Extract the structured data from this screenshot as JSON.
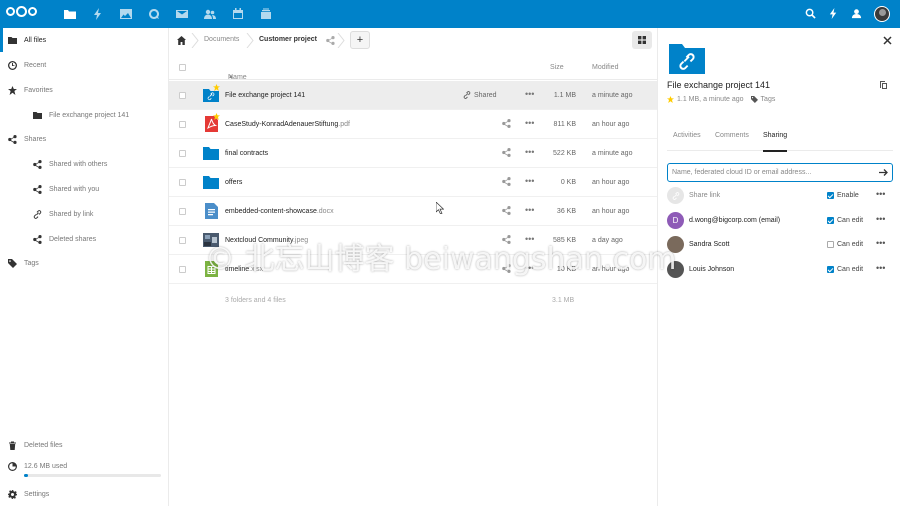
{
  "brand": {
    "accent": "#0082c9"
  },
  "topbar": {
    "apps": [
      "files-icon",
      "activity-icon",
      "gallery-icon",
      "talk-icon",
      "mail-icon",
      "contacts-icon",
      "calendar-icon",
      "deck-icon"
    ],
    "right_icons": [
      "search-icon",
      "notifications-icon",
      "contacts-menu-icon",
      "user-avatar"
    ]
  },
  "sidebar": {
    "items": [
      {
        "label": "All files",
        "icon": "folder-icon"
      },
      {
        "label": "Recent",
        "icon": "clock-icon"
      },
      {
        "label": "Favorites",
        "icon": "star-icon"
      },
      {
        "label": "File exchange project 141",
        "icon": "folder-icon"
      },
      {
        "label": "Shares",
        "icon": "share-icon"
      },
      {
        "label": "Shared with others",
        "icon": "share-icon"
      },
      {
        "label": "Shared with you",
        "icon": "share-icon"
      },
      {
        "label": "Shared by link",
        "icon": "link-icon"
      },
      {
        "label": "Deleted shares",
        "icon": "share-icon"
      },
      {
        "label": "Tags",
        "icon": "tag-icon"
      }
    ],
    "deleted_files": "Deleted files",
    "quota": "12.6 MB used",
    "quota_fraction": 0.03,
    "settings": "Settings"
  },
  "breadcrumb": {
    "items": [
      "Documents",
      "Customer project"
    ],
    "add_label": "+"
  },
  "table": {
    "col_name": "Name",
    "col_size": "Size",
    "col_modified": "Modified",
    "rows": [
      {
        "name": "File exchange project 141",
        "ext": "",
        "type": "shared-folder",
        "size": "1.1 MB",
        "modified": "a minute ago",
        "shared": "Shared",
        "favorite": true
      },
      {
        "name": "CaseStudy-KonradAdenauerStiftung",
        "ext": ".pdf",
        "type": "pdf",
        "size": "811 KB",
        "modified": "an hour ago",
        "favorite": true
      },
      {
        "name": "final contracts",
        "ext": "",
        "type": "folder",
        "size": "522 KB",
        "modified": "a minute ago"
      },
      {
        "name": "offers",
        "ext": "",
        "type": "folder",
        "size": "0 KB",
        "modified": "an hour ago"
      },
      {
        "name": "embedded-content-showcase",
        "ext": ".docx",
        "type": "doc",
        "size": "36 KB",
        "modified": "an hour ago"
      },
      {
        "name": "Nextcloud Community",
        "ext": ".jpeg",
        "type": "image",
        "size": "585 KB",
        "modified": "a day ago"
      },
      {
        "name": "timeline",
        "ext": ".xlsx",
        "type": "sheet",
        "size": "10 KB",
        "modified": "an hour ago"
      }
    ],
    "summary": "3 folders and 4 files",
    "total_size": "3.1 MB"
  },
  "details": {
    "title": "File exchange project 141",
    "meta": "1.1 MB, a minute ago",
    "tags": "Tags",
    "tabs": [
      "Activities",
      "Comments",
      "Sharing"
    ],
    "share_placeholder": "Name, federated cloud ID or email address...",
    "shares": [
      {
        "name": "Share link",
        "perm": "Enable",
        "checked": true,
        "avatar": "link",
        "color": "#e6e6e6",
        "muted": true
      },
      {
        "name": "d.wong@bigcorp.com (email)",
        "perm": "Can edit",
        "checked": true,
        "avatar": "D",
        "color": "#8e5bb7"
      },
      {
        "name": "Sandra Scott",
        "perm": "Can edit",
        "checked": false,
        "avatar": "photo",
        "color": "#7a6a5c"
      },
      {
        "name": "Louis Johnson",
        "perm": "Can edit",
        "checked": true,
        "avatar": "photo",
        "color": "#555555"
      }
    ]
  },
  "watermark": "© 北忘山博客 beiwangshan.com"
}
